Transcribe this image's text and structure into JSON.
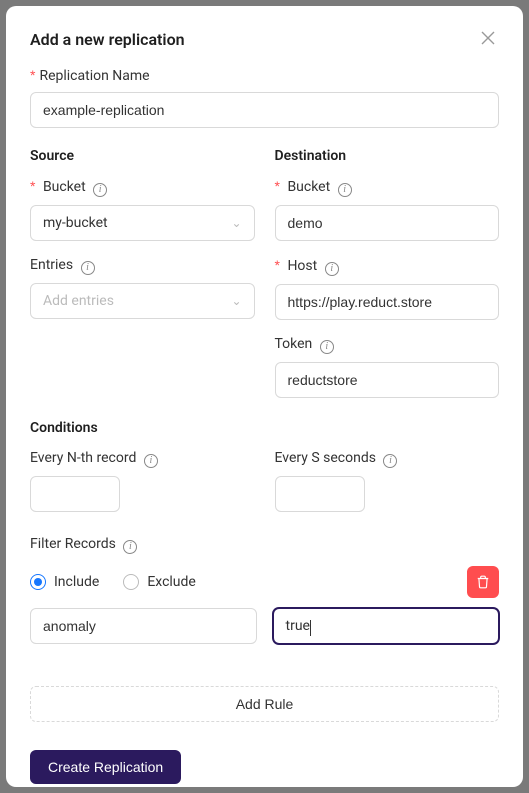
{
  "modal": {
    "title": "Add a new replication"
  },
  "form": {
    "name_label": "Replication Name",
    "name_value": "example-replication",
    "source": {
      "title": "Source",
      "bucket_label": "Bucket",
      "bucket_value": "my-bucket",
      "entries_label": "Entries",
      "entries_placeholder": "Add entries"
    },
    "destination": {
      "title": "Destination",
      "bucket_label": "Bucket",
      "bucket_value": "demo",
      "host_label": "Host",
      "host_value": "https://play.reduct.store",
      "token_label": "Token",
      "token_value": "reductstore"
    },
    "conditions": {
      "title": "Conditions",
      "nth_label": "Every N-th record",
      "nth_value": "",
      "sec_label": "Every S seconds",
      "sec_value": ""
    },
    "filter": {
      "title": "Filter Records",
      "include_label": "Include",
      "exclude_label": "Exclude",
      "selected": "include",
      "rules": [
        {
          "key": "anomaly",
          "value": "true"
        }
      ],
      "add_rule_label": "Add Rule"
    },
    "submit_label": "Create Replication"
  }
}
